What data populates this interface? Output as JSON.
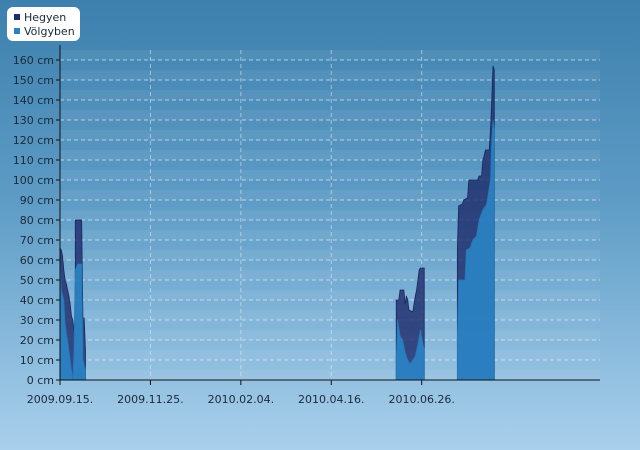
{
  "chart_data": {
    "type": "area",
    "title": "",
    "xlabel": "",
    "ylabel": "",
    "y_unit": "cm",
    "ylim": [
      0,
      165
    ],
    "y_ticks": [
      0,
      10,
      20,
      30,
      40,
      50,
      60,
      70,
      80,
      90,
      100,
      110,
      120,
      130,
      140,
      150,
      160
    ],
    "y_tick_labels": [
      "0 cm",
      "10 cm",
      "20 cm",
      "30 cm",
      "40 cm",
      "50 cm",
      "60 cm",
      "70 cm",
      "80 cm",
      "90 cm",
      "100 cm",
      "110 cm",
      "120 cm",
      "130 cm",
      "140 cm",
      "150 cm",
      "160 cm"
    ],
    "xlim": [
      "2009-09-15",
      "2010-11-13"
    ],
    "x_ticks": [
      "2009-09-15",
      "2009-11-25",
      "2010-02-04",
      "2010-04-16",
      "2010-06-26"
    ],
    "x_tick_labels": [
      "2009.09.15.",
      "2009.11.25.",
      "2010.02.04.",
      "2010.04.16.",
      "2010.06.26."
    ],
    "grid": true,
    "legend_position": "top-left",
    "series": [
      {
        "name": "Hegyen",
        "color": "#1f2d6b",
        "points": [
          [
            "2009-09-15",
            0
          ],
          [
            "2009-09-15",
            66
          ],
          [
            "2009-09-16",
            65
          ],
          [
            "2009-09-17",
            62
          ],
          [
            "2009-09-18",
            55
          ],
          [
            "2009-09-19",
            50
          ],
          [
            "2009-09-20",
            48
          ],
          [
            "2009-09-21",
            45
          ],
          [
            "2009-09-22",
            42
          ],
          [
            "2009-09-23",
            38
          ],
          [
            "2009-09-24",
            32
          ],
          [
            "2009-09-25",
            30
          ],
          [
            "2009-09-26",
            25
          ],
          [
            "2009-09-27",
            20
          ],
          [
            "2009-09-27",
            80
          ],
          [
            "2009-10-02",
            80
          ],
          [
            "2009-10-03",
            31
          ],
          [
            "2009-10-04",
            31
          ],
          [
            "2009-10-05",
            15
          ],
          [
            "2009-10-05",
            0
          ],
          [
            "2010-06-06",
            0
          ],
          [
            "2010-06-06",
            40
          ],
          [
            "2010-06-08",
            40
          ],
          [
            "2010-06-09",
            45
          ],
          [
            "2010-06-12",
            45
          ],
          [
            "2010-06-13",
            38
          ],
          [
            "2010-06-14",
            42
          ],
          [
            "2010-06-15",
            40
          ],
          [
            "2010-06-16",
            35
          ],
          [
            "2010-06-19",
            34
          ],
          [
            "2010-06-20",
            38
          ],
          [
            "2010-06-21",
            42
          ],
          [
            "2010-06-22",
            45
          ],
          [
            "2010-06-23",
            50
          ],
          [
            "2010-06-24",
            55
          ],
          [
            "2010-06-25",
            56
          ],
          [
            "2010-06-28",
            56
          ],
          [
            "2010-06-28",
            0
          ],
          [
            "2010-07-24",
            0
          ],
          [
            "2010-07-24",
            65
          ],
          [
            "2010-07-25",
            87
          ],
          [
            "2010-07-28",
            88
          ],
          [
            "2010-07-29",
            90
          ],
          [
            "2010-08-01",
            91
          ],
          [
            "2010-08-02",
            100
          ],
          [
            "2010-08-09",
            100
          ],
          [
            "2010-08-10",
            102
          ],
          [
            "2010-08-12",
            102
          ],
          [
            "2010-08-13",
            110
          ],
          [
            "2010-08-14",
            112
          ],
          [
            "2010-08-15",
            115
          ],
          [
            "2010-08-18",
            115
          ],
          [
            "2010-08-19",
            125
          ],
          [
            "2010-08-20",
            140
          ],
          [
            "2010-08-21",
            157
          ],
          [
            "2010-08-22",
            155
          ],
          [
            "2010-08-22",
            0
          ]
        ]
      },
      {
        "name": "Völgyben",
        "color": "#2b82c2",
        "points": [
          [
            "2009-09-15",
            0
          ],
          [
            "2009-09-15",
            60
          ],
          [
            "2009-09-16",
            45
          ],
          [
            "2009-09-18",
            40
          ],
          [
            "2009-09-19",
            28
          ],
          [
            "2009-09-21",
            20
          ],
          [
            "2009-09-23",
            10
          ],
          [
            "2009-09-24",
            5
          ],
          [
            "2009-09-25",
            0
          ],
          [
            "2009-09-26",
            15
          ],
          [
            "2009-09-27",
            55
          ],
          [
            "2009-09-29",
            58
          ],
          [
            "2009-10-01",
            58
          ],
          [
            "2009-10-02",
            58
          ],
          [
            "2009-10-03",
            10
          ],
          [
            "2009-10-05",
            5
          ],
          [
            "2009-10-05",
            0
          ],
          [
            "2010-06-06",
            0
          ],
          [
            "2010-06-06",
            10
          ],
          [
            "2010-06-07",
            30
          ],
          [
            "2010-06-09",
            22
          ],
          [
            "2010-06-11",
            20
          ],
          [
            "2010-06-13",
            14
          ],
          [
            "2010-06-15",
            10
          ],
          [
            "2010-06-17",
            8
          ],
          [
            "2010-06-19",
            10
          ],
          [
            "2010-06-21",
            12
          ],
          [
            "2010-06-23",
            18
          ],
          [
            "2010-06-25",
            25
          ],
          [
            "2010-06-27",
            18
          ],
          [
            "2010-06-28",
            15
          ],
          [
            "2010-06-28",
            0
          ],
          [
            "2010-07-24",
            0
          ],
          [
            "2010-07-24",
            22
          ],
          [
            "2010-07-25",
            50
          ],
          [
            "2010-07-30",
            50
          ],
          [
            "2010-07-31",
            65
          ],
          [
            "2010-08-03",
            66
          ],
          [
            "2010-08-05",
            70
          ],
          [
            "2010-08-08",
            72
          ],
          [
            "2010-08-10",
            80
          ],
          [
            "2010-08-13",
            85
          ],
          [
            "2010-08-16",
            88
          ],
          [
            "2010-08-19",
            100
          ],
          [
            "2010-08-20",
            120
          ],
          [
            "2010-08-21",
            130
          ],
          [
            "2010-08-22",
            125
          ],
          [
            "2010-08-22",
            0
          ]
        ]
      }
    ]
  }
}
